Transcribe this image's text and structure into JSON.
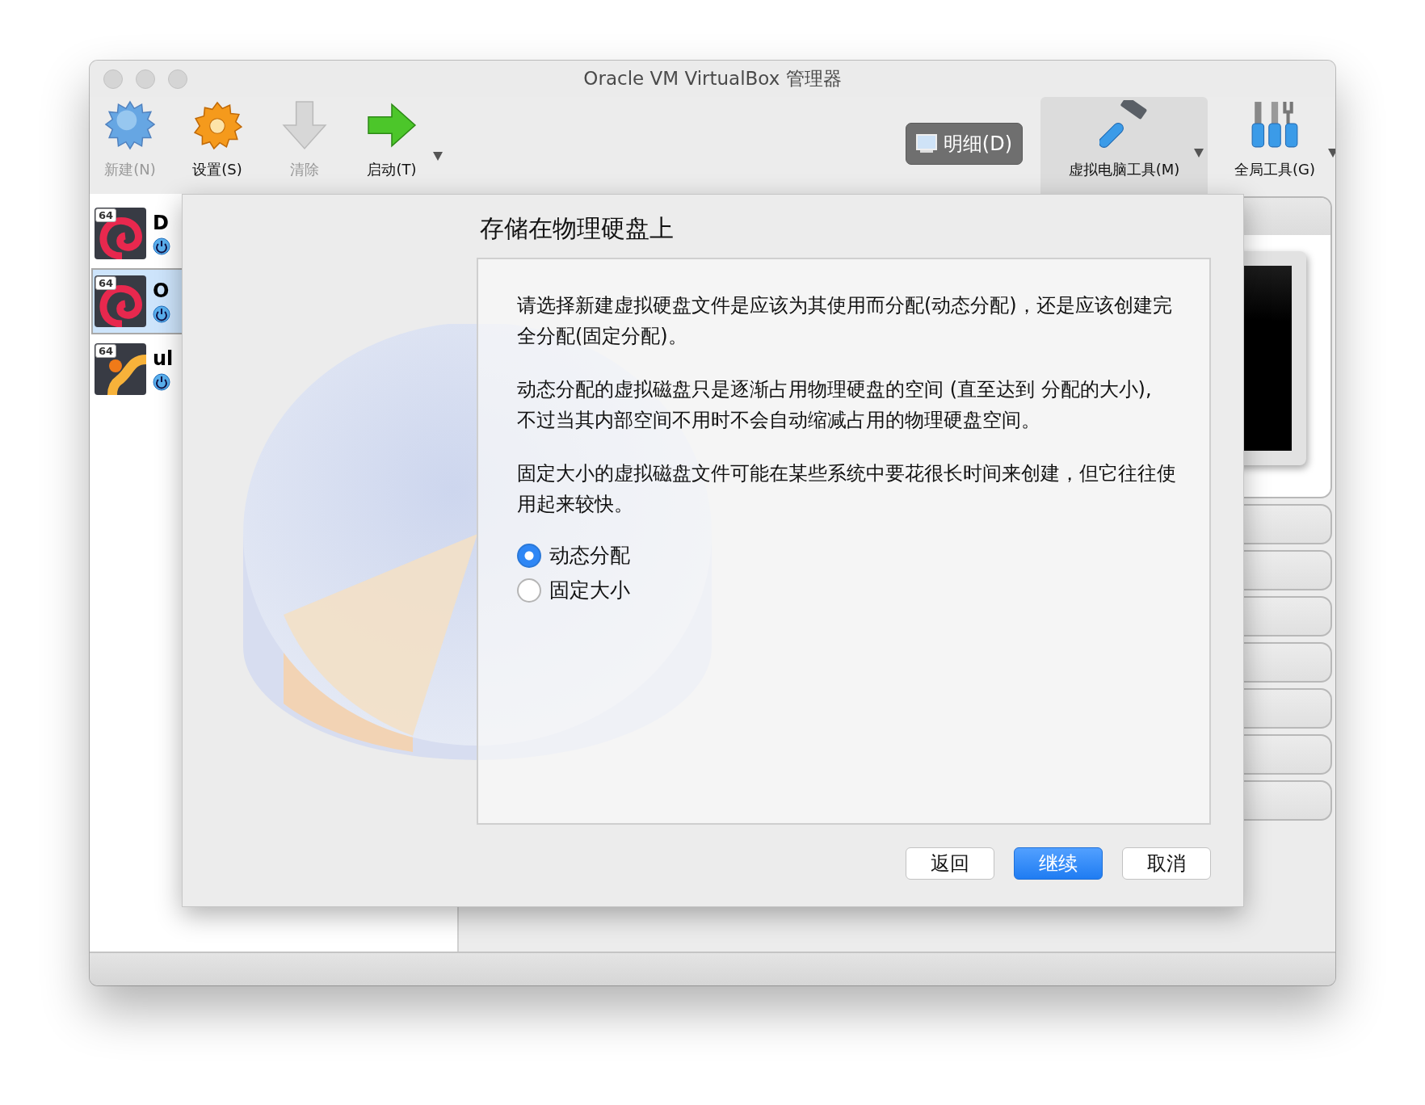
{
  "window": {
    "title": "Oracle VM VirtualBox 管理器"
  },
  "toolbar": {
    "actions": [
      {
        "label": "新建(N)",
        "kind": "new",
        "disabled": true,
        "menu": false
      },
      {
        "label": "设置(S)",
        "kind": "settings",
        "disabled": false,
        "menu": false
      },
      {
        "label": "清除",
        "kind": "discard",
        "disabled": true,
        "menu": false
      },
      {
        "label": "启动(T)",
        "kind": "start",
        "disabled": false,
        "menu": true
      }
    ],
    "details_button": {
      "label": "明细(D)"
    },
    "tool_tabs": [
      {
        "label": "虚拟电脑工具(M)",
        "kind": "machine",
        "selected": true,
        "menu": true
      },
      {
        "label": "全局工具(G)",
        "kind": "global",
        "selected": false,
        "menu": true
      }
    ]
  },
  "vm_list": [
    {
      "name": "D",
      "badge": "64",
      "kind": "debian",
      "selected": false
    },
    {
      "name": "O",
      "badge": "64",
      "kind": "debian",
      "selected": true
    },
    {
      "name": "ul",
      "badge": "64",
      "kind": "ubuntu",
      "selected": false
    }
  ],
  "dialog": {
    "title": "存储在物理硬盘上",
    "paragraphs": [
      "请选择新建虚拟硬盘文件是应该为其使用而分配(动态分配)，还是应该创建完全分配(固定分配)。",
      "动态分配的虚拟磁盘只是逐渐占用物理硬盘的空间 (直至达到 分配的大小), 不过当其内部空间不用时不会自动缩减占用的物理硬盘空间。",
      "固定大小的虚拟磁盘文件可能在某些系统中要花很长时间来创建，但它往往使用起来较快。"
    ],
    "options": [
      {
        "label": "动态分配",
        "selected": true
      },
      {
        "label": "固定大小",
        "selected": false
      }
    ],
    "buttons": [
      {
        "label": "返回",
        "kind": "default"
      },
      {
        "label": "继续",
        "kind": "primary"
      },
      {
        "label": "取消",
        "kind": "default"
      }
    ]
  }
}
